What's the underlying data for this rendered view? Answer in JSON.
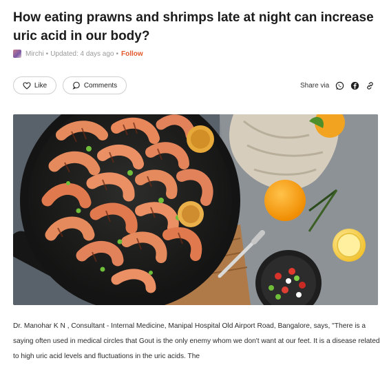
{
  "article": {
    "title": "How eating prawns and shrimps late at night can increase uric acid in our body?",
    "author": "Mirchi",
    "sep1": "•",
    "updated": "Updated: 4 days ago",
    "sep2": "•",
    "follow_label": "Follow"
  },
  "actions": {
    "like_label": "Like",
    "comments_label": "Comments",
    "share_label": "Share via"
  },
  "icons": {
    "like": "heart-icon",
    "comments": "comment-bubble-icon",
    "whatsapp": "whatsapp-icon",
    "facebook": "facebook-icon",
    "copy_link": "link-icon"
  },
  "body": {
    "paragraph": "Dr. Manohar K N , Consultant - Internal Medicine, Manipal Hospital Old Airport Road, Bangalore, says, \"There is a saying often used in medical circles that Gout is the only enemy whom we don't want at our feet. It is a disease related to high uric acid levels and fluctuations in the uric acids. The"
  },
  "colors": {
    "accent": "#e3572b",
    "meta_text": "#9a9a9a"
  }
}
